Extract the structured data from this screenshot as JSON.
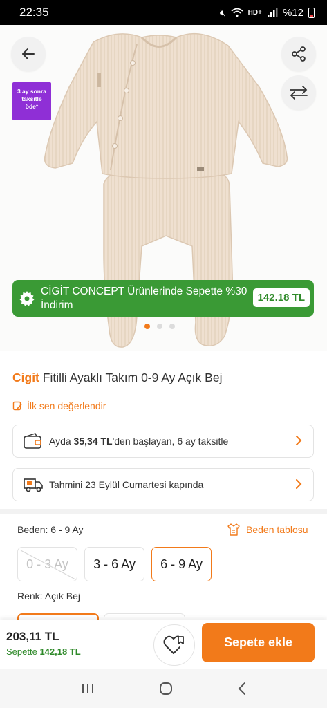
{
  "status_bar": {
    "time": "22:35",
    "battery_text": "%12",
    "icons": [
      "mute-icon",
      "wifi-icon",
      "volte-icon",
      "signal-icon",
      "battery-icon"
    ]
  },
  "hero": {
    "promo_badge": [
      "3 ay sonra",
      "taksitle",
      "öde*"
    ],
    "campaign_text": "CİGİT CONCEPT Ürünlerinde Sepette %30 İndirim",
    "campaign_price": "142.18 TL",
    "slides_total": 3,
    "slide_active": 1
  },
  "product": {
    "brand": "Cigit",
    "name": "Fitilli Ayaklı Takım 0-9 Ay Açık Bej",
    "rate_label": "İlk sen değerlendir"
  },
  "installment": {
    "prefix": "Ayda ",
    "amount": "35,34 TL",
    "suffix": "'den başlayan, 6 ay taksitle"
  },
  "delivery": {
    "text": "Tahmini 23 Eylül Cumartesi kapında"
  },
  "variants": {
    "size_label": "Beden: 6 - 9 Ay",
    "size_chart_label": "Beden tablosu",
    "sizes": [
      {
        "label": "0 - 3 Ay",
        "state": "unavailable"
      },
      {
        "label": "3 - 6 Ay",
        "state": "available"
      },
      {
        "label": "6 - 9 Ay",
        "state": "selected"
      }
    ],
    "color_label": "Renk: Açık Bej"
  },
  "bottom_bar": {
    "price": "203,11 TL",
    "basket_prefix": "Sepette ",
    "basket_price": "142,18 TL",
    "add_to_cart": "Sepete ekle"
  },
  "colors": {
    "accent": "#f27a1a",
    "green": "#3a9a35",
    "purple": "#8f2fd6"
  }
}
